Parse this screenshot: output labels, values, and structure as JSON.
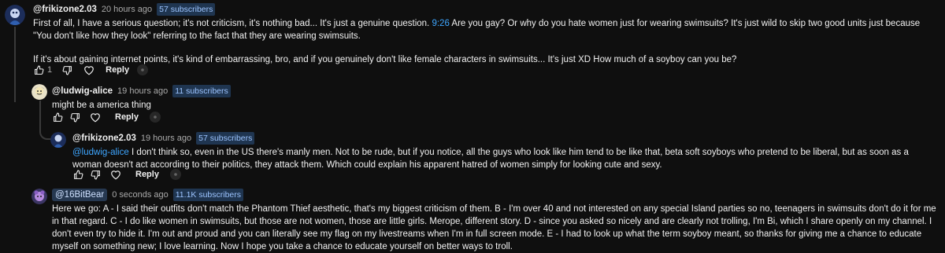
{
  "comments": [
    {
      "handle": "@frikizone2.03",
      "time": "20 hours ago",
      "subs": "57 subscribers",
      "text_a": "First of all, I have a serious question; it's not criticism, it's nothing bad... It's just a genuine question. ",
      "timestamp_link": "9:26",
      "text_b": " Are you gay? Or why do you hate women just for wearing swimsuits? It's just wild to skip two good units just because \"You don't like how they look\" referring to the fact that they are wearing swimsuits.",
      "text_c": "If it's about gaining internet points, it's kind of embarrassing, bro, and if you genuinely don't like female characters in swimsuits... It's just XD How much of a soyboy can you be?",
      "like_count": "1",
      "reply_label": "Reply"
    },
    {
      "handle": "@ludwig-alice",
      "time": "19 hours ago",
      "subs": "11 subscribers",
      "text": "might be a america thing",
      "reply_label": "Reply"
    },
    {
      "handle": "@frikizone2.03",
      "time": "19 hours ago",
      "subs": "57 subscribers",
      "mention": "@ludwig-alice",
      "text": "  I don't think so, even in the US there's manly men.  Not to be rude, but if you notice, all the guys who look like him tend to be like that, beta soft soyboys who pretend to be liberal, but as soon as a woman doesn't act according to their politics, they attack them. Which could explain his apparent hatred of women simply for looking cute and sexy.",
      "reply_label": "Reply"
    },
    {
      "handle": "@16BitBear",
      "time": "0 seconds ago",
      "subs": "11.1K subscribers",
      "text": "Here we go: A - I said their outfits don't match the Phantom Thief aesthetic, that's my biggest criticism of them. B - I'm over 40 and not interested on any special Island parties so no, teenagers in swimsuits don't do it for me in that regard. C - I do like women in swimsuits, but those are not women, those are little girls. Merope, different story. D - since you asked so nicely and are clearly not trolling, I'm Bi, which I share openly on my channel. I don't even try to hide it. I'm out and proud and you can literally see my flag on my livestreams when I'm in full screen mode. E - I had to look up what the term soyboy meant, so thanks for giving me a chance to educate myself on something new; I love learning. Now I hope you take a chance to educate yourself on better ways to troll."
    }
  ],
  "icons": [
    "thumbs-up-icon",
    "thumbs-down-icon",
    "heart-icon",
    "creator-heart-icon"
  ],
  "colors": {
    "background": "#0f0f0f",
    "link": "#3ea6ff",
    "subs_badge": "#1f3550",
    "muted": "#aaaaaa"
  }
}
